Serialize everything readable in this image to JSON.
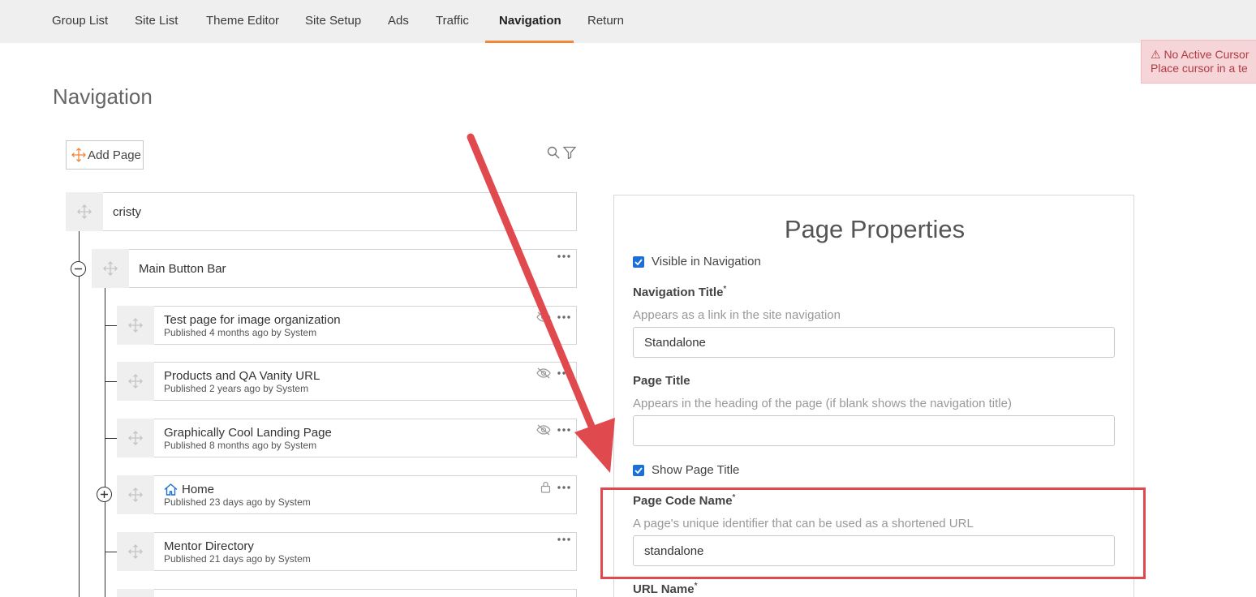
{
  "topnav": {
    "tabs": [
      {
        "label": "Group List"
      },
      {
        "label": "Site List"
      },
      {
        "label": "Theme Editor"
      },
      {
        "label": "Site Setup"
      },
      {
        "label": "Ads"
      },
      {
        "label": "Traffic"
      },
      {
        "label": "Navigation",
        "active": true
      },
      {
        "label": "Return"
      }
    ]
  },
  "alert": {
    "line1": "⚠ No Active Cursor",
    "line2": "Place cursor in a te"
  },
  "page_title": "Navigation",
  "toolbar": {
    "add_page_label": "Add Page"
  },
  "tree": {
    "root": {
      "title": "cristy"
    },
    "group": {
      "title": "Main Button Bar"
    },
    "pages": [
      {
        "title": "Test page for image organization",
        "meta": "Published 4 months ago by System"
      },
      {
        "title": "Products and QA Vanity URL",
        "meta": "Published 2 years ago by System"
      },
      {
        "title": "Graphically Cool Landing Page",
        "meta": "Published 8 months ago by System"
      },
      {
        "title": "Home",
        "meta": "Published 23 days ago by System"
      },
      {
        "title": "Mentor Directory",
        "meta": "Published 21 days ago by System"
      }
    ]
  },
  "properties": {
    "title": "Page Properties",
    "visible_in_navigation": "Visible in Navigation",
    "navigation_title": {
      "label": "Navigation Title",
      "required": "*",
      "hint": "Appears as a link in the site navigation",
      "value": "Standalone"
    },
    "page_title": {
      "label": "Page Title",
      "hint": "Appears in the heading of the page (if blank shows the navigation title)",
      "value": ""
    },
    "show_page_title": "Show Page Title",
    "page_code_name": {
      "label": "Page Code Name",
      "required": "*",
      "hint": "A page's unique identifier that can be used as a shortened URL",
      "value": "standalone"
    },
    "url_name": {
      "label": "URL Name",
      "required": "*"
    }
  },
  "colors": {
    "accent": "#f0883a",
    "checkbox": "#1c6fd6",
    "annotation": "#e04a4f"
  }
}
